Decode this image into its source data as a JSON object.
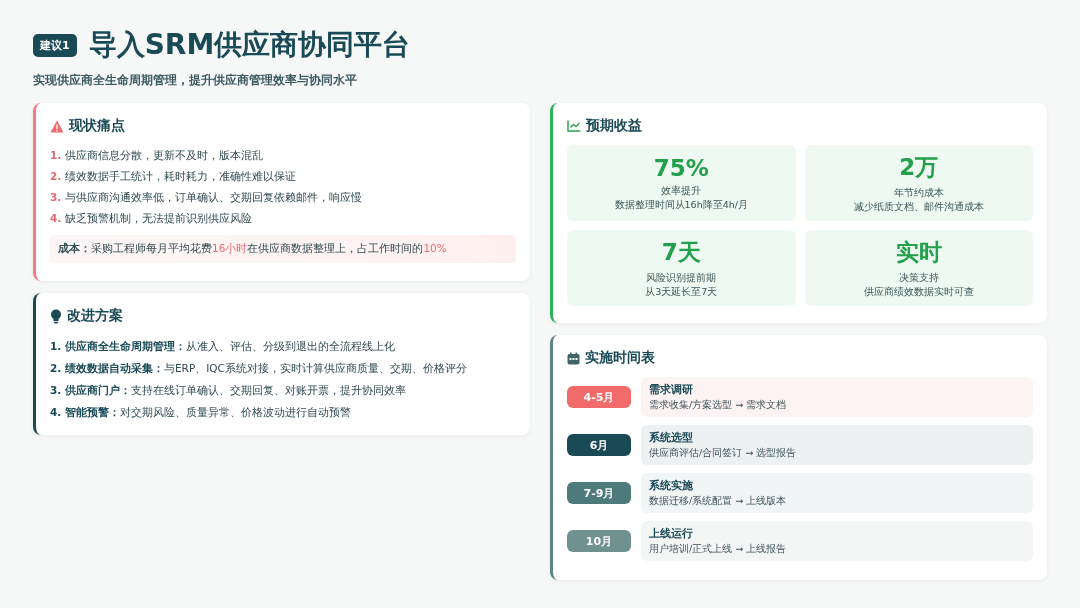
{
  "header": {
    "badge": "建议1",
    "title": "导入SRM供应商协同平台",
    "subtitle": "实现供应商全生命周期管理，提升供应商管理效率与协同水平"
  },
  "pain_points": {
    "title": "现状痛点",
    "items": [
      {
        "number": "1.",
        "text": "供应商信息分散，更新不及时，版本混乱"
      },
      {
        "number": "2.",
        "text": "绩效数据手工统计，耗时耗力，准确性难以保证"
      },
      {
        "number": "3.",
        "text": "与供应商沟通效率低，订单确认、交期回复依赖邮件，响应慢"
      },
      {
        "number": "4.",
        "text": "缺乏预警机制，无法提前识别供应风险"
      }
    ],
    "cost": {
      "label": "成本：",
      "parts": [
        {
          "text": "采购工程师每月平均花费",
          "highlight": false
        },
        {
          "text": "16小时",
          "highlight": true
        },
        {
          "text": "在供应商数据整理上，占工作时间的",
          "highlight": false
        },
        {
          "text": "10%",
          "highlight": true
        }
      ]
    }
  },
  "solutions": {
    "title": "改进方案",
    "items": [
      "**1. 供应商全生命周期管理：**从准入、评估、分级到退出的全流程线上化",
      "**2. 绩效数据自动采集：**与ERP、IQC系统对接，实时计算供应商质量、交期、价格评分",
      "**3. 供应商门户：**支持在线订单确认、交期回复、对账开票，提升协同效率",
      "**4. 智能预警：**对交期风险、质量异常、价格波动进行自动预警"
    ]
  },
  "benefits": {
    "title": "预期收益",
    "items": [
      {
        "value": "75%",
        "label": "效率提升",
        "detail": "数据整理时间从16h降至4h/月"
      },
      {
        "value": "2万",
        "label": "年节约成本",
        "detail": "减少纸质文档、邮件沟通成本"
      },
      {
        "value": "7天",
        "label": "风险识别提前期",
        "detail": "从3天延长至7天"
      },
      {
        "value": "实时",
        "label": "决策支持",
        "detail": "供应商绩效数据实时可查"
      }
    ]
  },
  "timeline": {
    "title": "实施时间表",
    "phases": [
      {
        "period": "4-5月",
        "color": "#f26b6b",
        "name": "需求调研",
        "detail": "需求收集/方案选型 → 需求文档"
      },
      {
        "period": "6月",
        "color": "#1b4a57",
        "name": "系统选型",
        "detail": "供应商评估/合同签订 → 选型报告"
      },
      {
        "period": "7-9月",
        "color": "#4e7a7c",
        "name": "系统实施",
        "detail": "数据迁移/系统配置 → 上线版本"
      },
      {
        "period": "10月",
        "color": "#6f9190",
        "name": "上线运行",
        "detail": "用户培训/正式上线 → 上线报告"
      }
    ]
  }
}
